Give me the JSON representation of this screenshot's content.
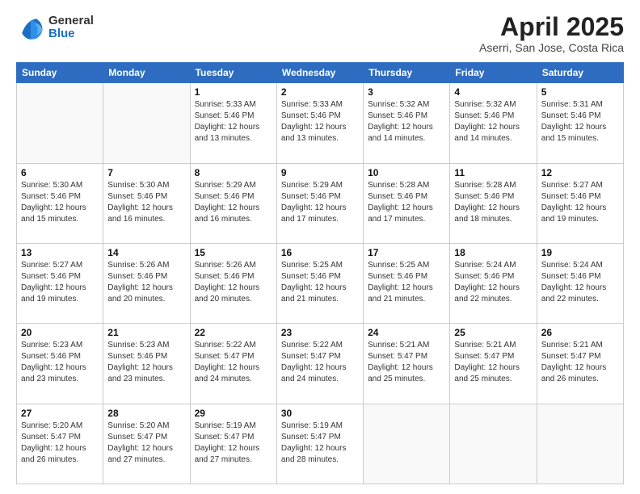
{
  "logo": {
    "general": "General",
    "blue": "Blue"
  },
  "header": {
    "month_title": "April 2025",
    "subtitle": "Aserri, San Jose, Costa Rica"
  },
  "days_of_week": [
    "Sunday",
    "Monday",
    "Tuesday",
    "Wednesday",
    "Thursday",
    "Friday",
    "Saturday"
  ],
  "weeks": [
    [
      {
        "day": "",
        "sunrise": "",
        "sunset": "",
        "daylight": ""
      },
      {
        "day": "",
        "sunrise": "",
        "sunset": "",
        "daylight": ""
      },
      {
        "day": "1",
        "sunrise": "Sunrise: 5:33 AM",
        "sunset": "Sunset: 5:46 PM",
        "daylight": "Daylight: 12 hours and 13 minutes."
      },
      {
        "day": "2",
        "sunrise": "Sunrise: 5:33 AM",
        "sunset": "Sunset: 5:46 PM",
        "daylight": "Daylight: 12 hours and 13 minutes."
      },
      {
        "day": "3",
        "sunrise": "Sunrise: 5:32 AM",
        "sunset": "Sunset: 5:46 PM",
        "daylight": "Daylight: 12 hours and 14 minutes."
      },
      {
        "day": "4",
        "sunrise": "Sunrise: 5:32 AM",
        "sunset": "Sunset: 5:46 PM",
        "daylight": "Daylight: 12 hours and 14 minutes."
      },
      {
        "day": "5",
        "sunrise": "Sunrise: 5:31 AM",
        "sunset": "Sunset: 5:46 PM",
        "daylight": "Daylight: 12 hours and 15 minutes."
      }
    ],
    [
      {
        "day": "6",
        "sunrise": "Sunrise: 5:30 AM",
        "sunset": "Sunset: 5:46 PM",
        "daylight": "Daylight: 12 hours and 15 minutes."
      },
      {
        "day": "7",
        "sunrise": "Sunrise: 5:30 AM",
        "sunset": "Sunset: 5:46 PM",
        "daylight": "Daylight: 12 hours and 16 minutes."
      },
      {
        "day": "8",
        "sunrise": "Sunrise: 5:29 AM",
        "sunset": "Sunset: 5:46 PM",
        "daylight": "Daylight: 12 hours and 16 minutes."
      },
      {
        "day": "9",
        "sunrise": "Sunrise: 5:29 AM",
        "sunset": "Sunset: 5:46 PM",
        "daylight": "Daylight: 12 hours and 17 minutes."
      },
      {
        "day": "10",
        "sunrise": "Sunrise: 5:28 AM",
        "sunset": "Sunset: 5:46 PM",
        "daylight": "Daylight: 12 hours and 17 minutes."
      },
      {
        "day": "11",
        "sunrise": "Sunrise: 5:28 AM",
        "sunset": "Sunset: 5:46 PM",
        "daylight": "Daylight: 12 hours and 18 minutes."
      },
      {
        "day": "12",
        "sunrise": "Sunrise: 5:27 AM",
        "sunset": "Sunset: 5:46 PM",
        "daylight": "Daylight: 12 hours and 19 minutes."
      }
    ],
    [
      {
        "day": "13",
        "sunrise": "Sunrise: 5:27 AM",
        "sunset": "Sunset: 5:46 PM",
        "daylight": "Daylight: 12 hours and 19 minutes."
      },
      {
        "day": "14",
        "sunrise": "Sunrise: 5:26 AM",
        "sunset": "Sunset: 5:46 PM",
        "daylight": "Daylight: 12 hours and 20 minutes."
      },
      {
        "day": "15",
        "sunrise": "Sunrise: 5:26 AM",
        "sunset": "Sunset: 5:46 PM",
        "daylight": "Daylight: 12 hours and 20 minutes."
      },
      {
        "day": "16",
        "sunrise": "Sunrise: 5:25 AM",
        "sunset": "Sunset: 5:46 PM",
        "daylight": "Daylight: 12 hours and 21 minutes."
      },
      {
        "day": "17",
        "sunrise": "Sunrise: 5:25 AM",
        "sunset": "Sunset: 5:46 PM",
        "daylight": "Daylight: 12 hours and 21 minutes."
      },
      {
        "day": "18",
        "sunrise": "Sunrise: 5:24 AM",
        "sunset": "Sunset: 5:46 PM",
        "daylight": "Daylight: 12 hours and 22 minutes."
      },
      {
        "day": "19",
        "sunrise": "Sunrise: 5:24 AM",
        "sunset": "Sunset: 5:46 PM",
        "daylight": "Daylight: 12 hours and 22 minutes."
      }
    ],
    [
      {
        "day": "20",
        "sunrise": "Sunrise: 5:23 AM",
        "sunset": "Sunset: 5:46 PM",
        "daylight": "Daylight: 12 hours and 23 minutes."
      },
      {
        "day": "21",
        "sunrise": "Sunrise: 5:23 AM",
        "sunset": "Sunset: 5:46 PM",
        "daylight": "Daylight: 12 hours and 23 minutes."
      },
      {
        "day": "22",
        "sunrise": "Sunrise: 5:22 AM",
        "sunset": "Sunset: 5:47 PM",
        "daylight": "Daylight: 12 hours and 24 minutes."
      },
      {
        "day": "23",
        "sunrise": "Sunrise: 5:22 AM",
        "sunset": "Sunset: 5:47 PM",
        "daylight": "Daylight: 12 hours and 24 minutes."
      },
      {
        "day": "24",
        "sunrise": "Sunrise: 5:21 AM",
        "sunset": "Sunset: 5:47 PM",
        "daylight": "Daylight: 12 hours and 25 minutes."
      },
      {
        "day": "25",
        "sunrise": "Sunrise: 5:21 AM",
        "sunset": "Sunset: 5:47 PM",
        "daylight": "Daylight: 12 hours and 25 minutes."
      },
      {
        "day": "26",
        "sunrise": "Sunrise: 5:21 AM",
        "sunset": "Sunset: 5:47 PM",
        "daylight": "Daylight: 12 hours and 26 minutes."
      }
    ],
    [
      {
        "day": "27",
        "sunrise": "Sunrise: 5:20 AM",
        "sunset": "Sunset: 5:47 PM",
        "daylight": "Daylight: 12 hours and 26 minutes."
      },
      {
        "day": "28",
        "sunrise": "Sunrise: 5:20 AM",
        "sunset": "Sunset: 5:47 PM",
        "daylight": "Daylight: 12 hours and 27 minutes."
      },
      {
        "day": "29",
        "sunrise": "Sunrise: 5:19 AM",
        "sunset": "Sunset: 5:47 PM",
        "daylight": "Daylight: 12 hours and 27 minutes."
      },
      {
        "day": "30",
        "sunrise": "Sunrise: 5:19 AM",
        "sunset": "Sunset: 5:47 PM",
        "daylight": "Daylight: 12 hours and 28 minutes."
      },
      {
        "day": "",
        "sunrise": "",
        "sunset": "",
        "daylight": ""
      },
      {
        "day": "",
        "sunrise": "",
        "sunset": "",
        "daylight": ""
      },
      {
        "day": "",
        "sunrise": "",
        "sunset": "",
        "daylight": ""
      }
    ]
  ]
}
